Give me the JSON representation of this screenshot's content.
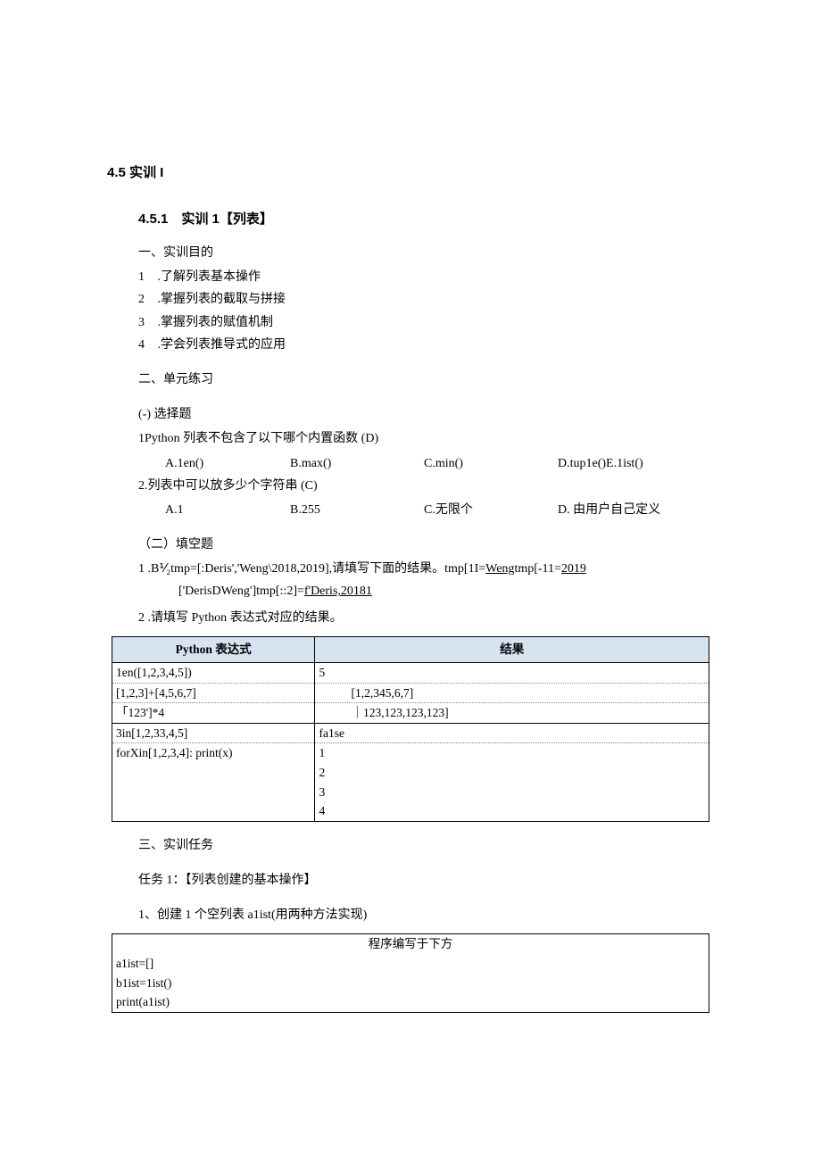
{
  "title_section": "4.5 实训 I",
  "subtitle": "4.5.1　实训 1【列表】",
  "sec1_heading": "一、实训目的",
  "goals": [
    {
      "n": "1",
      "t": " .了解列表基本操作"
    },
    {
      "n": "2",
      "t": " .掌握列表的截取与拼接"
    },
    {
      "n": "3",
      "t": " .掌握列表的赋值机制"
    },
    {
      "n": "4",
      "t": " .学会列表推导式的应用"
    }
  ],
  "sec2_heading": "二、单元练习",
  "sec2_sub1": "(-) 选择题",
  "q1_text": "1Python 列表不包含了以下哪个内置函数 (D)",
  "q1_opts": {
    "a": "A.1en()",
    "b": "B.max()",
    "c": "C.min()",
    "d": "D.tup1e()E.1ist()"
  },
  "q2_text": "2.列表中可以放多少个字符串 (C)",
  "q2_opts": {
    "a": "A.1",
    "b": "B.255",
    "c": "C.无限个",
    "d": "D. 由用户自己定义"
  },
  "sec2_sub2": "（二）填空题",
  "fill1_pre": "1  .B⅟₂tmp=[:Deris','Weng\\2018,2019],请填写下面的结果。tmp[1I=",
  "fill1_u1": "Weng",
  "fill1_mid": "tmp[-11=",
  "fill1_u2": "2019",
  "fill1_line2_pre": "['DerisDWeng']tmp[::2]=",
  "fill1_line2_u": "f'Deris,20181",
  "fill2": "2  .请填写 Python 表达式对应的结果。",
  "table_headers": {
    "c1": "Python 表达式",
    "c2": "结果"
  },
  "rows": [
    {
      "expr": "1en([1,2,3,4,5])",
      "res": "5"
    },
    {
      "expr": "[1,2,3]+[4,5,6,7]",
      "res": "[1,2,345,6,7]"
    },
    {
      "expr": "「123']*4",
      "res": "｜123,123,123,123]"
    },
    {
      "expr": "3in[1,2,33,4,5]",
      "res": "fa1se"
    },
    {
      "expr": "forXin[1,2,3,4]:  print(x)",
      "res": "1\n2\n3\n4"
    }
  ],
  "sec3_heading": "三、实训任务",
  "task1_title": "任务 1：【列表创建的基本操作】",
  "task1_step": "1、创建 1 个空列表 a1ist(用两种方法实现)",
  "code_header": "程序编写于下方",
  "code_lines": [
    "a1ist=[]",
    "b1ist=1ist()",
    "print(a1ist)"
  ]
}
